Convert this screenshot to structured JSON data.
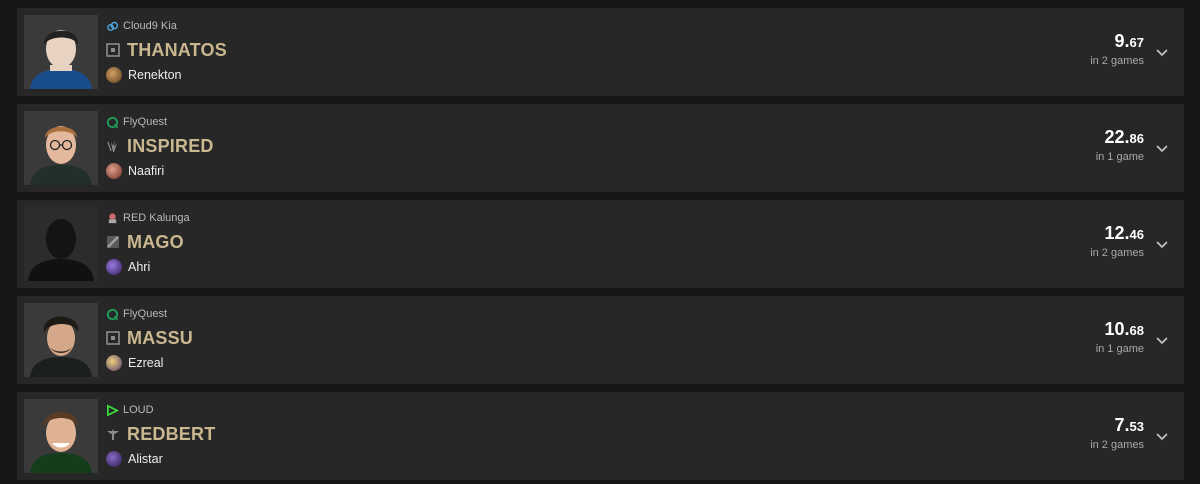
{
  "players": [
    {
      "team": "Cloud9 Kia",
      "team_logo": "cloud-icon",
      "team_color": "#4ea7e0",
      "name": "THANATOS",
      "role": "top",
      "champion": "Renekton",
      "champion_color": "#9b6a36",
      "score_int": "9.",
      "score_dec": "67",
      "games": "in 2 games"
    },
    {
      "team": "FlyQuest",
      "team_logo": "flyquest-icon",
      "team_color": "#1f9b5c",
      "name": "INSPIRED",
      "role": "jungle",
      "champion": "Naafiri",
      "champion_color": "#b05a4d",
      "score_int": "22.",
      "score_dec": "86",
      "games": "in 1 game"
    },
    {
      "team": "RED Kalunga",
      "team_logo": "red-kalunga-icon",
      "team_color": "#c9676e",
      "name": "MAGO",
      "role": "mid",
      "champion": "Ahri",
      "champion_color": "#7a58b8",
      "score_int": "12.",
      "score_dec": "46",
      "games": "in 2 games"
    },
    {
      "team": "FlyQuest",
      "team_logo": "flyquest-icon",
      "team_color": "#1f9b5c",
      "name": "MASSU",
      "role": "bot",
      "champion": "Ezreal",
      "champion_color": "#c59b48",
      "score_int": "10.",
      "score_dec": "68",
      "games": "in 1 game"
    },
    {
      "team": "LOUD",
      "team_logo": "loud-icon",
      "team_color": "#38e03b",
      "name": "REDBERT",
      "role": "support",
      "champion": "Alistar",
      "champion_color": "#6a4aa0",
      "score_int": "7.",
      "score_dec": "53",
      "games": "in 2 games"
    }
  ]
}
